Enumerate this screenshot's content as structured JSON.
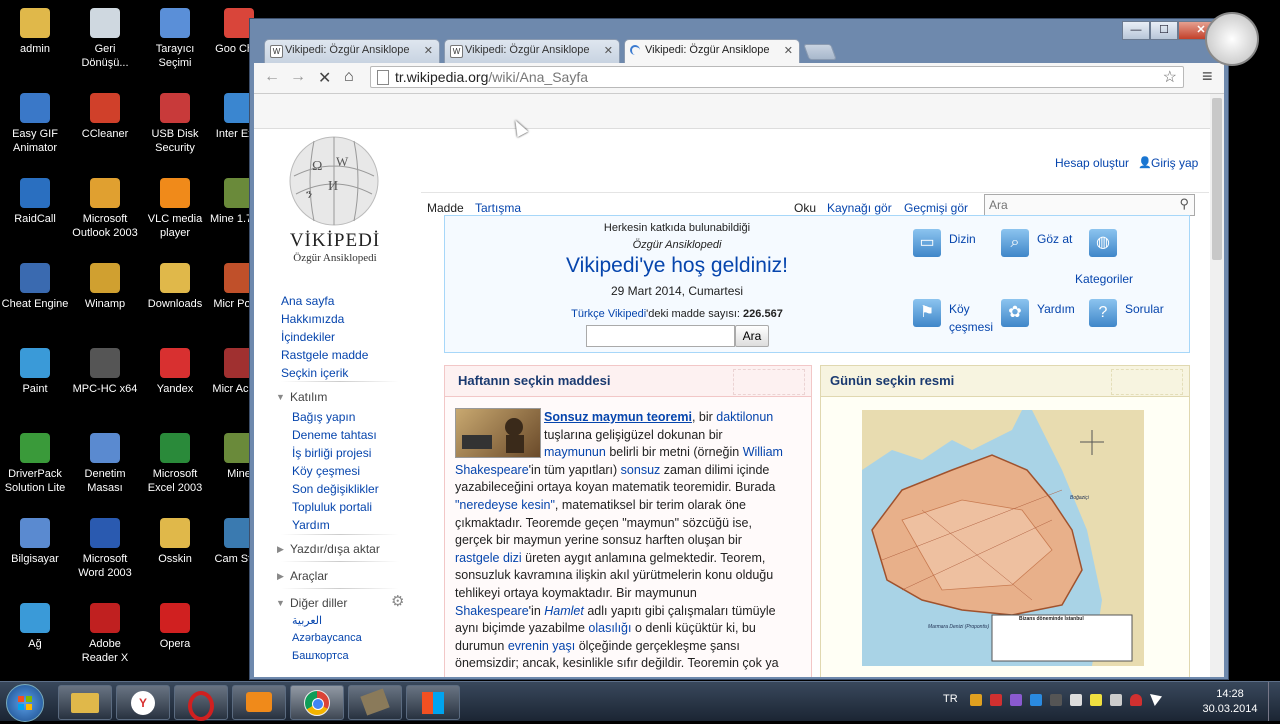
{
  "desktop": {
    "icons": [
      {
        "label": "admin",
        "color": "#e0b84a"
      },
      {
        "label": "Geri Dönüşü...",
        "color": "#cfd8e0"
      },
      {
        "label": "Tarayıcı Seçimi",
        "color": "#5a8fd8"
      },
      {
        "label": "Goo Chro",
        "color": "#d9453a"
      },
      {
        "label": "Easy GIF Animator",
        "color": "#3a78c8"
      },
      {
        "label": "CCleaner",
        "color": "#d0402a"
      },
      {
        "label": "USB Disk Security",
        "color": "#c83a3a"
      },
      {
        "label": "Inter Expl",
        "color": "#3a86d0"
      },
      {
        "label": "RaidCall",
        "color": "#2a6fc0"
      },
      {
        "label": "Microsoft Outlook 2003",
        "color": "#e0a030"
      },
      {
        "label": "VLC media player",
        "color": "#f08a1a"
      },
      {
        "label": "Mine 1.7.2 -",
        "color": "#6a8a3a"
      },
      {
        "label": "Cheat Engine",
        "color": "#3a6ab0"
      },
      {
        "label": "Winamp",
        "color": "#d0a030"
      },
      {
        "label": "Downloads",
        "color": "#e0b84a"
      },
      {
        "label": "Micr Powe",
        "color": "#c0502a"
      },
      {
        "label": "Paint",
        "color": "#3a9ad8"
      },
      {
        "label": "MPC-HC x64",
        "color": "#555"
      },
      {
        "label": "Yandex",
        "color": "#d83030"
      },
      {
        "label": "Micr Acces",
        "color": "#a03030"
      },
      {
        "label": "DriverPack Solution Lite",
        "color": "#3a9a3a"
      },
      {
        "label": "Denetim Masası",
        "color": "#5a8ad0"
      },
      {
        "label": "Microsoft Excel 2003",
        "color": "#2a8a3a"
      },
      {
        "label": "Mine",
        "color": "#6a8a3a"
      },
      {
        "label": "Bilgisayar",
        "color": "#5a8ad0"
      },
      {
        "label": "Microsoft Word 2003",
        "color": "#2a5ab0"
      },
      {
        "label": "Osskin",
        "color": "#e0b84a"
      },
      {
        "label": "Cam Stud",
        "color": "#3a7ab0"
      },
      {
        "label": "Ağ",
        "color": "#3a9ad8"
      },
      {
        "label": "Adobe Reader X",
        "color": "#c02020"
      },
      {
        "label": "Opera",
        "color": "#d02020"
      }
    ]
  },
  "browser": {
    "tabs": [
      {
        "title": "Vikipedi: Özgür Ansiklope"
      },
      {
        "title": "Vikipedi: Özgür Ansiklope"
      },
      {
        "title": "Vikipedi: Özgür Ansiklope"
      }
    ],
    "url_host": "tr.wikipedia.org",
    "url_path": "/wiki/Ana_Sayfa",
    "tab_close": "✕",
    "win_min": "—",
    "win_max": "☐",
    "win_close": "✕"
  },
  "wiki": {
    "logo_title": "VİKİPEDİ",
    "logo_subtitle": "Özgür Ansiklopedi",
    "create_account": "Hesap oluştur",
    "login": "Giriş yap",
    "tabs_left": [
      "Madde",
      "Tartışma"
    ],
    "tabs_right": [
      "Oku",
      "Kaynağı gör",
      "Geçmişi gör"
    ],
    "search_placeholder": "Ara",
    "sidebar_main": [
      "Ana sayfa",
      "Hakkımızda",
      "İçindekiler",
      "Rastgele madde",
      "Seçkin içerik"
    ],
    "participation_header": "Katılım",
    "sidebar_participation": [
      "Bağış yapın",
      "Deneme tahtası",
      "İş birliği projesi",
      "Köy çeşmesi",
      "Son değişiklikler",
      "Topluluk portali",
      "Yardım"
    ],
    "print_export": "Yazdır/dışa aktar",
    "tools": "Araçlar",
    "other_languages": "Diğer diller",
    "languages": [
      "العربية",
      "Azərbaycanca",
      "Башҡортса"
    ],
    "welcome": {
      "top": "Herkesin katkıda bulunabildiği",
      "sub": "Özgür Ansiklopedi",
      "title": "Vikipedi'ye hoş geldiniz!",
      "date": "29 Mart 2014, Cumartesi",
      "count_prefix": "Türkçe Vikipedi",
      "count_mid": "'deki madde sayısı: ",
      "count_value": "226.567",
      "search_button": "Ara"
    },
    "portal_links": [
      {
        "label": "Dizin",
        "icon": "▭"
      },
      {
        "label": "Göz at",
        "icon": "⌕"
      },
      {
        "label": "Kategoriler",
        "icon": "◍"
      },
      {
        "label": "Köy çeşmesi",
        "icon": "⚑"
      },
      {
        "label": "Yardım",
        "icon": "✿"
      },
      {
        "label": "Sorular",
        "icon": "?"
      }
    ],
    "featured": {
      "header": "Haftanın seçkin maddesi",
      "lines": [
        [
          "Sonsuz maymun teoremi",
          ", bir ",
          "daktilonun"
        ],
        [
          "tuşlarına gelişigüzel dokunan bir"
        ],
        [
          "maymunun",
          " belirli bir metni (örneğin ",
          "William"
        ],
        [
          "Shakespeare",
          "'in tüm yapıtları) ",
          "sonsuz",
          " zaman dilimi içinde"
        ],
        [
          "yazabileceğini ortaya koyan matematik teoremidir. Burada"
        ],
        [
          "\"neredeyse kesin\"",
          ", matematiksel bir terim olarak öne"
        ],
        [
          "çıkmaktadır. Teoremde geçen \"maymun\" sözcüğü ise,"
        ],
        [
          "gerçek bir maymun yerine sonsuz harften oluşan bir"
        ],
        [
          "rastgele dizi",
          " üreten aygıt anlamına gelmektedir. Teorem,"
        ],
        [
          "sonsuzluk kavramına ilişkin akıl yürütmelerin konu olduğu"
        ],
        [
          "tehlikeyi ortaya koymaktadır. Bir maymunun"
        ],
        [
          "Shakespeare",
          "'in ",
          "Hamlet",
          " adlı yapıtı gibi çalışmaları tümüyle"
        ],
        [
          "aynı biçimde yazabilme ",
          "olasılığı",
          " o denli küçüktür ki, bu"
        ],
        [
          "durumun ",
          "evrenin yaşı",
          " ölçeğinde gerçekleşme şansı"
        ],
        [
          "önemsizdir; ancak, kesinlikle sıfır değildir. Teoremin çok ya"
        ]
      ]
    },
    "picture": {
      "header": "Günün seçkin resmi",
      "caption": "Bizans döneminde İstanbul",
      "map_labels": [
        "Boğaziçi",
        "Marmara Denizi (Propontis)"
      ]
    }
  },
  "taskbar": {
    "lang": "TR",
    "time": "14:28",
    "date": "30.03.2014"
  },
  "colors": {
    "link": "#0645ad",
    "box_border": "#a7d7f9",
    "featured_bg": "#f5fffa",
    "welcome_bg": "#f5faff"
  }
}
